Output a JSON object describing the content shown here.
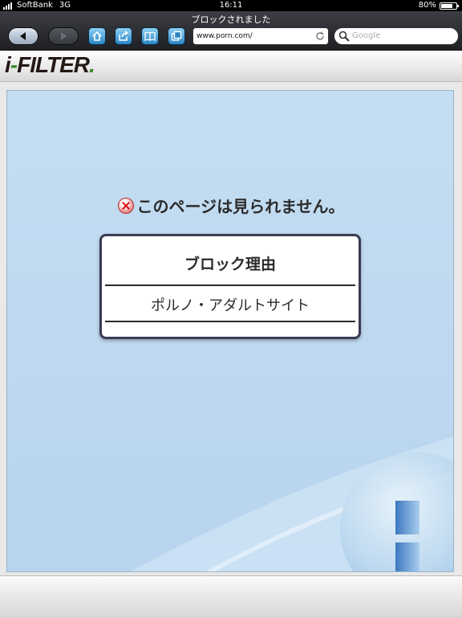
{
  "status": {
    "carrier": "SoftBank",
    "network": "3G",
    "time": "16:11",
    "battery": "80%",
    "battery_level": 0.8
  },
  "browser": {
    "page_title": "ブロックされました",
    "url": "www.porn.com/",
    "search_placeholder": "Google"
  },
  "brand": {
    "logo_i": "i",
    "logo_dash": "-",
    "logo_text": "FILTER",
    "logo_dot": "."
  },
  "block": {
    "message": "このページは見られません。",
    "reason_heading": "ブロック理由",
    "reason": "ポルノ・アダルトサイト"
  },
  "colors": {
    "panel_bg": "#c0daf1",
    "toolbar_bg": "#2e3034",
    "icon_button": "#3aa0dc"
  }
}
